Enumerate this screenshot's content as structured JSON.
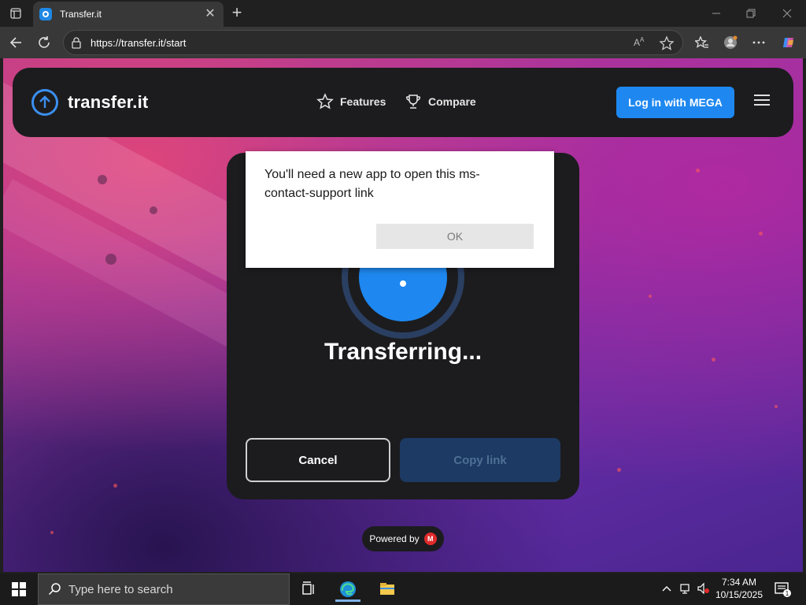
{
  "browser": {
    "tab_title": "Transfer.it",
    "url": "https://transfer.it/start",
    "reader_icon": "read-aloud-icon"
  },
  "site": {
    "logo_text": "transfer.it",
    "nav": [
      {
        "label": "Features",
        "icon": "star-outline-icon"
      },
      {
        "label": "Compare",
        "icon": "trophy-icon"
      }
    ],
    "login_label": "Log in with MEGA",
    "menu_icon": "hamburger-menu-icon"
  },
  "transfer": {
    "status": "Transferring...",
    "cancel_label": "Cancel",
    "copy_label": "Copy link"
  },
  "footer": {
    "powered_label": "Powered by",
    "mega_glyph": "M"
  },
  "dialog": {
    "message": "You'll need a new app to open this ms-contact-support link",
    "ok_label": "OK"
  },
  "taskbar": {
    "search_placeholder": "Type here to search",
    "time": "7:34 AM",
    "date": "10/15/2025",
    "notification_count": "1"
  },
  "colors": {
    "accent_blue": "#1e88f0",
    "card_bg": "#1c1c1e",
    "disabled_button": "#1c3a63"
  }
}
